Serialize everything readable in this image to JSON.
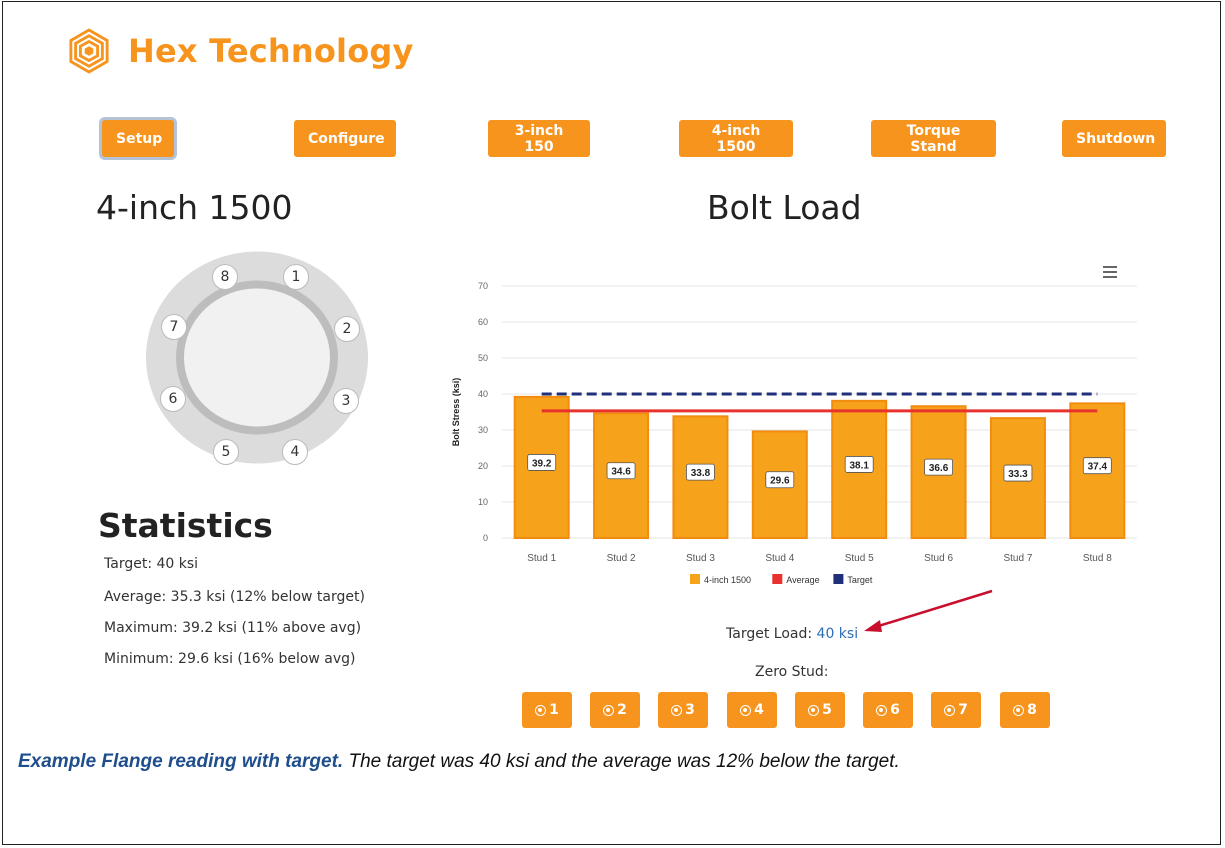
{
  "brand": {
    "name": "Hex Technology",
    "color": "#f7941d",
    "icon": "hexagon-logo-icon"
  },
  "nav": {
    "buttons": [
      {
        "label": "Setup",
        "active": true
      },
      {
        "label": "Configure"
      },
      {
        "label": "3-inch 150"
      },
      {
        "label": "4-inch 1500"
      },
      {
        "label": "Torque Stand"
      },
      {
        "label": "Shutdown"
      }
    ]
  },
  "flange": {
    "title": "4-inch 1500",
    "studs": [
      "1",
      "2",
      "3",
      "4",
      "5",
      "6",
      "7",
      "8"
    ]
  },
  "chart": {
    "title": "Bolt Load",
    "menu_icon": "hamburger-menu-icon"
  },
  "chart_data": {
    "type": "bar",
    "categories": [
      "Stud 1",
      "Stud 2",
      "Stud 3",
      "Stud 4",
      "Stud 5",
      "Stud 6",
      "Stud 7",
      "Stud 8"
    ],
    "series": [
      {
        "name": "4-inch 1500",
        "type": "bar",
        "color": "#f7a21b",
        "values": [
          39.2,
          34.6,
          33.8,
          29.6,
          38.1,
          36.6,
          33.3,
          37.4
        ]
      },
      {
        "name": "Average",
        "type": "line",
        "color": "#e8322d",
        "values": [
          35.3,
          35.3,
          35.3,
          35.3,
          35.3,
          35.3,
          35.3,
          35.3
        ]
      },
      {
        "name": "Target",
        "type": "line-dashed",
        "color": "#1f2f7a",
        "values": [
          40,
          40,
          40,
          40,
          40,
          40,
          40,
          40
        ]
      }
    ],
    "data_labels": [
      "39.2",
      "34.6",
      "33.8",
      "29.6",
      "38.1",
      "36.6",
      "33.3",
      "37.4"
    ],
    "ylabel": "Bolt Stress (ksi)",
    "ylim": [
      0,
      70
    ],
    "yticks": [
      "0",
      "10",
      "20",
      "30",
      "40",
      "50",
      "60",
      "70"
    ],
    "legend": "bottom",
    "grid": true
  },
  "statistics": {
    "title": "Statistics",
    "lines": [
      "Target: 40 ksi",
      "Average: 35.3 ksi (12% below target)",
      "Maximum: 39.2 ksi (11% above avg)",
      "Minimum: 29.6 ksi (16% below avg)"
    ]
  },
  "target_load": {
    "label": "Target Load:",
    "value": "40 ksi"
  },
  "zero_stud": {
    "label": "Zero Stud:",
    "buttons": [
      "1",
      "2",
      "3",
      "4",
      "5",
      "6",
      "7",
      "8"
    ]
  },
  "caption": {
    "bold": "Example Flange reading with target.",
    "text": " The target was 40 ksi and the average was 12% below the target."
  }
}
